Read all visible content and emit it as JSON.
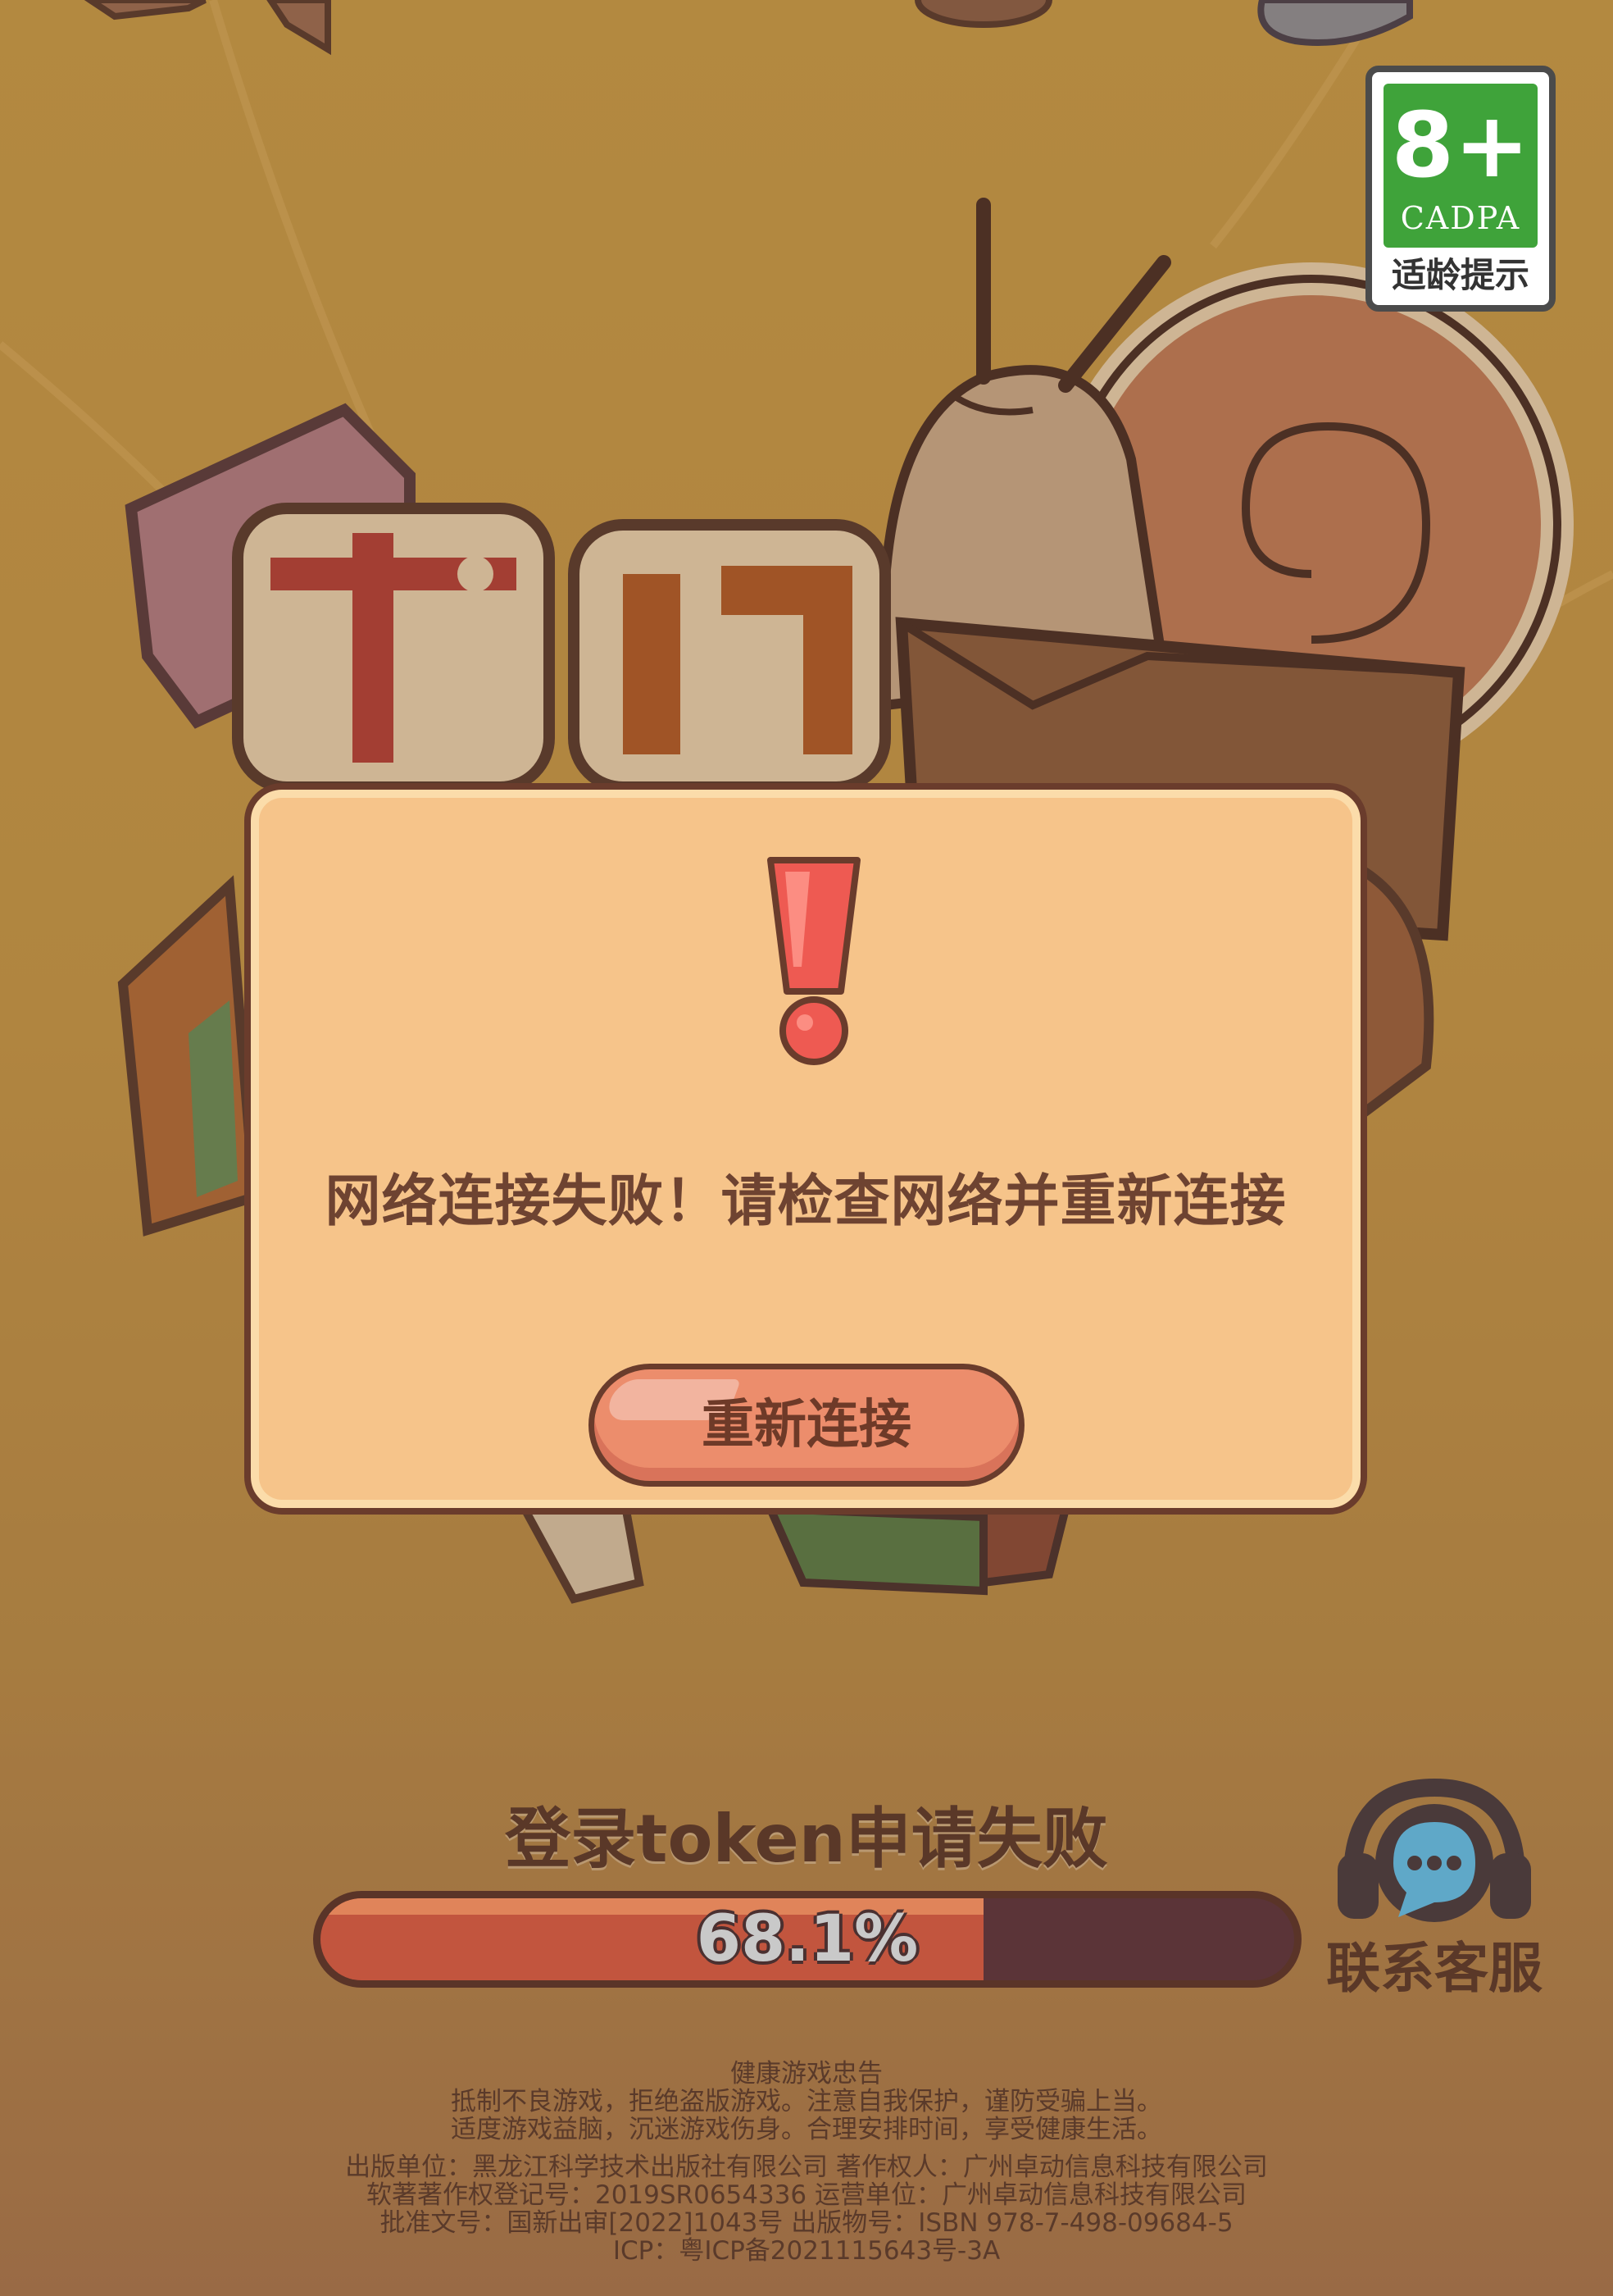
{
  "age_rating": {
    "rating": "8+",
    "org": "CADPA",
    "label": "适龄提示"
  },
  "dialog": {
    "message": "网络连接失败！请检查网络并重新连接",
    "button_label": "重新连接"
  },
  "loading": {
    "status": "登录token申请失败",
    "progress_label": "68.1%",
    "progress": 0.681
  },
  "support": {
    "label": "联系客服"
  },
  "footer": {
    "title": "健康游戏忠告",
    "advisory_1": "抵制不良游戏，拒绝盗版游戏。注意自我保护，谨防受骗上当。",
    "advisory_2": "适度游戏益脑，沉迷游戏伤身。合理安排时间，享受健康生活。",
    "publisher": "出版单位：黑龙江科学技术出版社有限公司   著作权人：广州卓动信息科技有限公司",
    "copyright": "软著著作权登记号：2019SR0654336   运营单位：广州卓动信息科技有限公司",
    "approval": "批准文号：国新出审[2022]1043号   出版物号：ISBN 978-7-498-09684-5",
    "icp": "ICP：粤ICP备2021115643号-3A"
  },
  "colors": {
    "background": "#c4954a",
    "dialog_fill": "#f6c48a",
    "button_fill": "#ec8d6c",
    "progress_fill": "#c2553e",
    "progress_track": "#5b3438",
    "badge_green": "#3fa33a"
  }
}
